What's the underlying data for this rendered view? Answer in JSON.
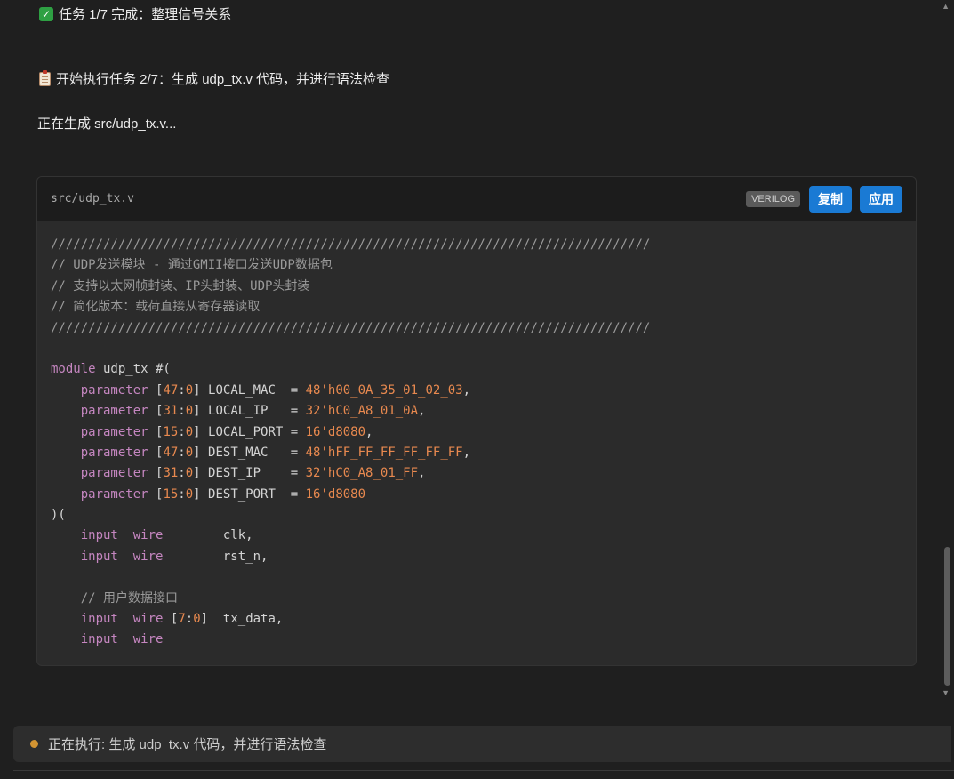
{
  "messages": {
    "task_done": "任务 1/7 完成：整理信号关系",
    "task_start": "开始执行任务 2/7：生成 udp_tx.v 代码，并进行语法检查",
    "generating": "正在生成 src/udp_tx.v..."
  },
  "code_block": {
    "file_name": "src/udp_tx.v",
    "language": "VERILOG",
    "copy_label": "复制",
    "apply_label": "应用",
    "lines": [
      [
        [
          "c-com",
          "////////////////////////////////////////////////////////////////////////////////"
        ]
      ],
      [
        [
          "c-com",
          "// UDP发送模块 - 通过GMII接口发送UDP数据包"
        ]
      ],
      [
        [
          "c-com",
          "// 支持以太网帧封装、IP头封装、UDP头封装"
        ]
      ],
      [
        [
          "c-com",
          "// 简化版本：载荷直接从寄存器读取"
        ]
      ],
      [
        [
          "c-com",
          "////////////////////////////////////////////////////////////////////////////////"
        ]
      ],
      [],
      [
        [
          "c-kw",
          "module"
        ],
        [
          "c-txt",
          " udp_tx #("
        ]
      ],
      [
        [
          "c-txt",
          "    "
        ],
        [
          "c-kw",
          "parameter"
        ],
        [
          "c-txt",
          " ["
        ],
        [
          "c-num",
          "47"
        ],
        [
          "c-txt",
          ":"
        ],
        [
          "c-num",
          "0"
        ],
        [
          "c-txt",
          "] LOCAL_MAC  = "
        ],
        [
          "c-num",
          "48'h00_0A_35_01_02_03"
        ],
        [
          "c-txt",
          ","
        ]
      ],
      [
        [
          "c-txt",
          "    "
        ],
        [
          "c-kw",
          "parameter"
        ],
        [
          "c-txt",
          " ["
        ],
        [
          "c-num",
          "31"
        ],
        [
          "c-txt",
          ":"
        ],
        [
          "c-num",
          "0"
        ],
        [
          "c-txt",
          "] LOCAL_IP   = "
        ],
        [
          "c-num",
          "32'hC0_A8_01_0A"
        ],
        [
          "c-txt",
          ","
        ]
      ],
      [
        [
          "c-txt",
          "    "
        ],
        [
          "c-kw",
          "parameter"
        ],
        [
          "c-txt",
          " ["
        ],
        [
          "c-num",
          "15"
        ],
        [
          "c-txt",
          ":"
        ],
        [
          "c-num",
          "0"
        ],
        [
          "c-txt",
          "] LOCAL_PORT = "
        ],
        [
          "c-num",
          "16'd8080"
        ],
        [
          "c-txt",
          ","
        ]
      ],
      [
        [
          "c-txt",
          "    "
        ],
        [
          "c-kw",
          "parameter"
        ],
        [
          "c-txt",
          " ["
        ],
        [
          "c-num",
          "47"
        ],
        [
          "c-txt",
          ":"
        ],
        [
          "c-num",
          "0"
        ],
        [
          "c-txt",
          "] DEST_MAC   = "
        ],
        [
          "c-num",
          "48'hFF_FF_FF_FF_FF_FF"
        ],
        [
          "c-txt",
          ","
        ]
      ],
      [
        [
          "c-txt",
          "    "
        ],
        [
          "c-kw",
          "parameter"
        ],
        [
          "c-txt",
          " ["
        ],
        [
          "c-num",
          "31"
        ],
        [
          "c-txt",
          ":"
        ],
        [
          "c-num",
          "0"
        ],
        [
          "c-txt",
          "] DEST_IP    = "
        ],
        [
          "c-num",
          "32'hC0_A8_01_FF"
        ],
        [
          "c-txt",
          ","
        ]
      ],
      [
        [
          "c-txt",
          "    "
        ],
        [
          "c-kw",
          "parameter"
        ],
        [
          "c-txt",
          " ["
        ],
        [
          "c-num",
          "15"
        ],
        [
          "c-txt",
          ":"
        ],
        [
          "c-num",
          "0"
        ],
        [
          "c-txt",
          "] DEST_PORT  = "
        ],
        [
          "c-num",
          "16'd8080"
        ]
      ],
      [
        [
          "c-txt",
          ")("
        ]
      ],
      [
        [
          "c-txt",
          "    "
        ],
        [
          "c-kw",
          "input"
        ],
        [
          "c-txt",
          "  "
        ],
        [
          "c-kw",
          "wire"
        ],
        [
          "c-txt",
          "        clk,"
        ]
      ],
      [
        [
          "c-txt",
          "    "
        ],
        [
          "c-kw",
          "input"
        ],
        [
          "c-txt",
          "  "
        ],
        [
          "c-kw",
          "wire"
        ],
        [
          "c-txt",
          "        rst_n,"
        ]
      ],
      [],
      [
        [
          "c-txt",
          "    "
        ],
        [
          "c-com",
          "// 用户数据接口"
        ]
      ],
      [
        [
          "c-txt",
          "    "
        ],
        [
          "c-kw",
          "input"
        ],
        [
          "c-txt",
          "  "
        ],
        [
          "c-kw",
          "wire"
        ],
        [
          "c-txt",
          " ["
        ],
        [
          "c-num",
          "7"
        ],
        [
          "c-txt",
          ":"
        ],
        [
          "c-num",
          "0"
        ],
        [
          "c-txt",
          "]  tx_data,"
        ]
      ],
      [
        [
          "c-txt",
          "    "
        ],
        [
          "c-kw",
          "input"
        ],
        [
          "c-txt",
          "  "
        ],
        [
          "c-kw",
          "wire"
        ]
      ]
    ]
  },
  "status": {
    "text": "正在执行: 生成 udp_tx.v 代码，并进行语法检查",
    "dot_color": "#d29432"
  },
  "icons": {
    "task_done": "check-icon",
    "task_start": "clipboard-icon"
  }
}
